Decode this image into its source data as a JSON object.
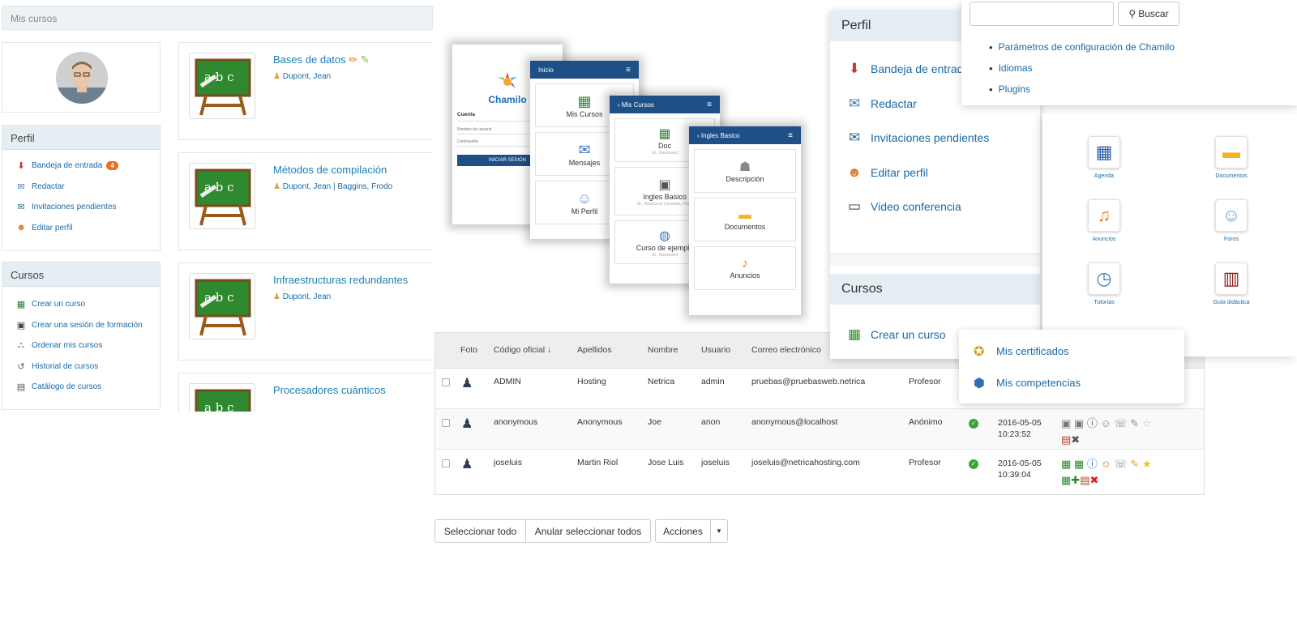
{
  "mis_cursos": {
    "breadcrumb": "Mis cursos",
    "perfil": {
      "title": "Perfil",
      "items": [
        {
          "label": "Bandeja de entrada",
          "badge": "4",
          "icon": "inbox-icon"
        },
        {
          "label": "Redactar",
          "icon": "compose-icon"
        },
        {
          "label": "Invitaciones pendientes",
          "icon": "invitations-icon"
        },
        {
          "label": "Editar perfil",
          "icon": "edit-profile-icon"
        }
      ]
    },
    "cursos": {
      "title": "Cursos",
      "items": [
        {
          "label": "Crear un curso",
          "icon": "create-course-icon"
        },
        {
          "label": "Crear una sesión de formación",
          "icon": "create-session-icon"
        },
        {
          "label": "Ordenar mis cursos",
          "icon": "sort-courses-icon"
        },
        {
          "label": "Historial de cursos",
          "icon": "history-icon"
        },
        {
          "label": "Catálogo de cursos",
          "icon": "catalog-icon"
        }
      ]
    },
    "courses": [
      {
        "title": "Bases de datos",
        "teachers": "Dupont, Jean"
      },
      {
        "title": "Métodos de compilación",
        "teachers": "Dupont, Jean | Baggins, Frodo"
      },
      {
        "title": "Infraestructuras redundantes",
        "teachers": "Dupont, Jean"
      },
      {
        "title": "Procesadores cuánticos",
        "teachers": ""
      }
    ]
  },
  "mobile": {
    "login": {
      "logo": "Chamilo",
      "section": "Cuenta",
      "username_placeholder": "Nombre de usuario",
      "password_placeholder": "Contraseña",
      "button": "INICIAR SESIÓN"
    },
    "inicio": {
      "title": "Inicio",
      "items": [
        "Mis Cursos",
        "Mensajes",
        "Mi Perfil"
      ]
    },
    "mis_cursos": {
      "title": "Mis Cursos",
      "items": [
        {
          "label": "Doc",
          "sub": "SL, Nosotured"
        },
        {
          "label": "Ingles Basico",
          "sub": "SL, Nosotured | pruebas, Profe"
        },
        {
          "label": "Curso de ejemplo",
          "sub": "SL, Nosotured"
        }
      ]
    },
    "ingles": {
      "title": "Ingles Basico",
      "items": [
        "Descripción",
        "Documentos",
        "Anuncios"
      ]
    }
  },
  "users_table": {
    "headers": [
      "Foto",
      "Código oficial ↓",
      "Apellidos",
      "Nombre",
      "Usuario",
      "Correo electrónico"
    ],
    "rows": [
      {
        "code": "ADMIN",
        "lastname": "Hosting",
        "firstname": "Netrica",
        "username": "admin",
        "email": "pruebas@pruebasweb.netrica",
        "profile": "Profesor",
        "date": "",
        "time": ""
      },
      {
        "code": "anonymous",
        "lastname": "Anonymous",
        "firstname": "Joe",
        "username": "anon",
        "email": "anonymous@localhost",
        "profile": "Anónimo",
        "date": "2016-05-05",
        "time": "10:23:52"
      },
      {
        "code": "joseluis",
        "lastname": "Martin Riol",
        "firstname": "Jose Luis",
        "username": "joseluis",
        "email": "joseluis@netricahosting.com",
        "profile": "Profesor",
        "date": "2016-05-05",
        "time": "10:39:04"
      }
    ],
    "buttons": {
      "select_all": "Seleccionar todo",
      "unselect_all": "Anular seleccionar todos",
      "actions": "Acciones"
    }
  },
  "perfil_large": {
    "title": "Perfil",
    "items": [
      {
        "label": "Bandeja de entrada",
        "icon": "inbox-icon"
      },
      {
        "label": "Redactar",
        "icon": "compose-icon"
      },
      {
        "label": "Invitaciones pendientes",
        "icon": "invitations-icon"
      },
      {
        "label": "Editar perfil",
        "icon": "edit-profile-icon"
      },
      {
        "label": "Video conferencia",
        "icon": "video-conference-icon"
      }
    ],
    "cursos_title": "Cursos",
    "cursos_item": "Crear un curso"
  },
  "admin": {
    "search_button": "Buscar",
    "links": [
      "Parámetros de configuración de Chamilo",
      "Idiomas",
      "Plugins"
    ]
  },
  "tools": [
    {
      "label": "Agenda",
      "icon": "calendar-icon"
    },
    {
      "label": "Documentos",
      "icon": "folder-icon"
    },
    {
      "label": "Anuncios",
      "icon": "bell-icon"
    },
    {
      "label": "Foros",
      "icon": "forum-icon"
    },
    {
      "label": "Tutorías",
      "icon": "clock-icon"
    },
    {
      "label": "Guía didáctica",
      "icon": "book-icon"
    }
  ],
  "extras": {
    "items": [
      {
        "label": "Mis certificados",
        "icon": "certificate-icon"
      },
      {
        "label": "Mis competencias",
        "icon": "skills-icon"
      }
    ]
  },
  "colors": {
    "link": "#1a6aa6",
    "header_bg": "#e4eef3",
    "mobile_bar": "#1e4f86",
    "badge": "#f06b1e"
  }
}
